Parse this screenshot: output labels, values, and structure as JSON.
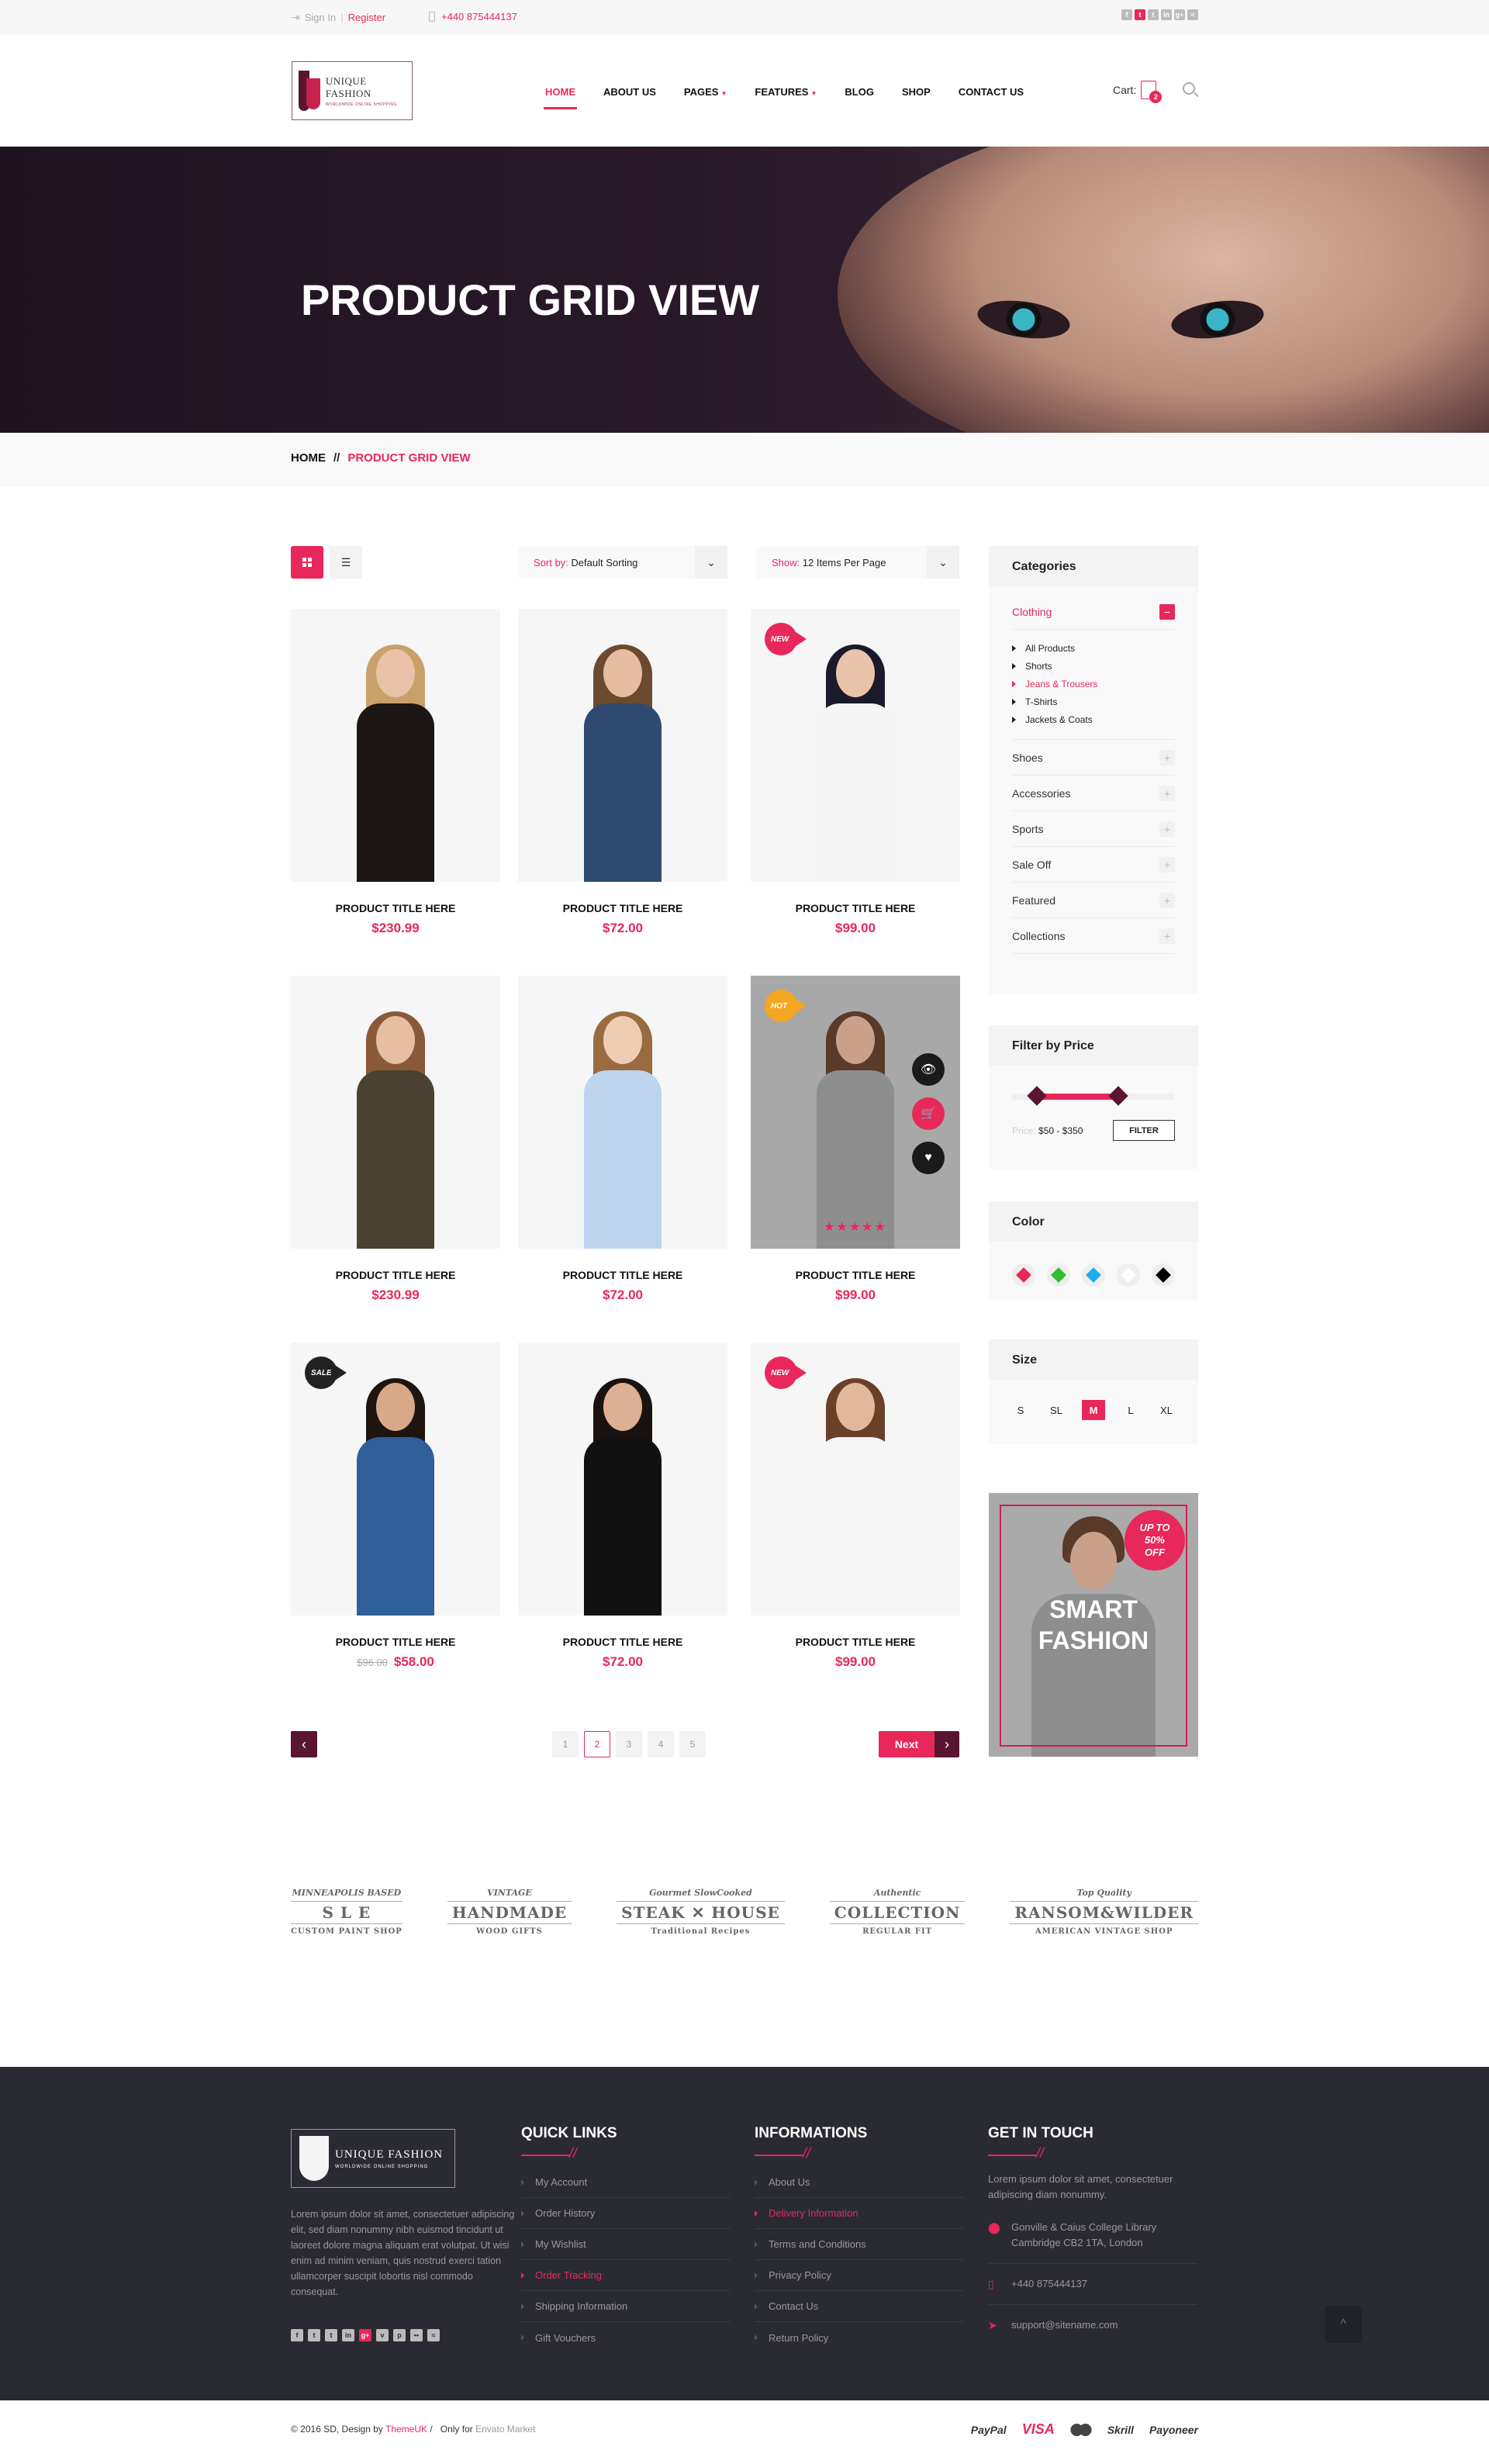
{
  "topbar": {
    "sign_in": "Sign In",
    "separator": "|",
    "register": "Register",
    "phone": "+440 875444137",
    "social": [
      {
        "icon": "facebook-icon",
        "glyph": "f",
        "active": false
      },
      {
        "icon": "twitter-icon",
        "glyph": "t",
        "active": true
      },
      {
        "icon": "tumblr-icon",
        "glyph": "t",
        "active": false
      },
      {
        "icon": "linkedin-icon",
        "glyph": "in",
        "active": false
      },
      {
        "icon": "google-plus-icon",
        "glyph": "g+",
        "active": false
      },
      {
        "icon": "rss-icon",
        "glyph": "≈",
        "active": false
      }
    ]
  },
  "header": {
    "logo_title": "UNIQUE FASHION",
    "logo_tagline": "WORLDWIDE ONLINE SHOPPING",
    "nav": [
      {
        "label": "HOME",
        "active": true,
        "dropdown": false
      },
      {
        "label": "ABOUT US",
        "active": false,
        "dropdown": false
      },
      {
        "label": "PAGES",
        "active": false,
        "dropdown": true
      },
      {
        "label": "FEATURES",
        "active": false,
        "dropdown": true
      },
      {
        "label": "BLOG",
        "active": false,
        "dropdown": false
      },
      {
        "label": "SHOP",
        "active": false,
        "dropdown": false
      },
      {
        "label": "CONTACT US",
        "active": false,
        "dropdown": false
      }
    ],
    "cart_label": "Cart:",
    "cart_count": "2"
  },
  "hero": {
    "title": "PRODUCT GRID VIEW"
  },
  "breadcrumb": {
    "home": "HOME",
    "separator": "//",
    "current": "PRODUCT GRID VIEW"
  },
  "toolbar": {
    "sort_label": "Sort by:",
    "sort_value": "Default Sorting",
    "show_label": "Show:",
    "show_value": "12 Items Per Page",
    "view_mode": "grid"
  },
  "products": [
    {
      "title": "PRODUCT TITLE HERE",
      "price": "$230.99",
      "old_price": null,
      "badge": null,
      "hair": "#c9a06a",
      "skin": "#e9c3a8",
      "outfit": "#1c1614"
    },
    {
      "title": "PRODUCT TITLE HERE",
      "price": "$72.00",
      "old_price": null,
      "badge": null,
      "hair": "#6b4a30",
      "skin": "#e6bda0",
      "outfit": "#2e4a70"
    },
    {
      "title": "PRODUCT TITLE HERE",
      "price": "$99.00",
      "old_price": null,
      "badge": "NEW",
      "badge_color": "#e8275a",
      "hair": "#1a1a2a",
      "skin": "#e8c4aa",
      "outfit": "#f5f5f5"
    },
    {
      "title": "PRODUCT TITLE HERE",
      "price": "$230.99",
      "old_price": null,
      "badge": null,
      "hair": "#8a5a38",
      "skin": "#e6bfa2",
      "outfit": "#4a4232"
    },
    {
      "title": "PRODUCT TITLE HERE",
      "price": "$72.00",
      "old_price": null,
      "badge": null,
      "hair": "#9a6a40",
      "skin": "#efcdb4",
      "outfit": "#bcd4ee"
    },
    {
      "title": "PRODUCT TITLE HERE",
      "price": "$99.00",
      "old_price": null,
      "badge": "HOT",
      "badge_color": "#f5a623",
      "hover": true,
      "rating": 5,
      "hair": "#5a3a28",
      "skin": "#c9a08a",
      "outfit": "#8e8e8e"
    },
    {
      "title": "PRODUCT TITLE HERE",
      "price": "$58.00",
      "old_price": "$96.00",
      "badge": "SALE",
      "badge_color": "#222222",
      "hair": "#1e1410",
      "skin": "#d8a888",
      "outfit": "#2f5f98"
    },
    {
      "title": "PRODUCT TITLE HERE",
      "price": "$72.00",
      "old_price": null,
      "badge": null,
      "hair": "#1a1210",
      "skin": "#dcb094",
      "outfit": "#111111"
    },
    {
      "title": "PRODUCT TITLE HERE",
      "price": "$99.00",
      "old_price": null,
      "badge": "NEW",
      "badge_color": "#e8275a",
      "hair": "#6a4028",
      "skin": "#e0b89c",
      "outfit": "#f6f6f6"
    }
  ],
  "product_actions": {
    "quick_view": "quick-view",
    "add_to_cart": "add-to-cart",
    "wishlist": "wishlist"
  },
  "pagination": {
    "pages": [
      "1",
      "2",
      "3",
      "4",
      "5"
    ],
    "current": "2",
    "prev": "‹",
    "next_label": "Next",
    "next_arrow": "›"
  },
  "sidebar": {
    "categories_title": "Categories",
    "categories": [
      {
        "label": "Clothing",
        "open": true,
        "toggle": "−",
        "children": [
          {
            "label": "All Products",
            "active": false
          },
          {
            "label": "Shorts",
            "active": false
          },
          {
            "label": "Jeans & Trousers",
            "active": true
          },
          {
            "label": "T-Shirts",
            "active": false
          },
          {
            "label": "Jackets & Coats",
            "active": false
          }
        ]
      },
      {
        "label": "Shoes",
        "open": false,
        "toggle": "+"
      },
      {
        "label": "Accessories",
        "open": false,
        "toggle": "+"
      },
      {
        "label": "Sports",
        "open": false,
        "toggle": "+"
      },
      {
        "label": "Sale Off",
        "open": false,
        "toggle": "+"
      },
      {
        "label": "Featured",
        "open": false,
        "toggle": "+"
      },
      {
        "label": "Collections",
        "open": false,
        "toggle": "+"
      }
    ],
    "price_title": "Filter by Price",
    "price_label": "Price:",
    "price_range": "$50 - $350",
    "price_slider": {
      "min_fraction": 0.15,
      "max_fraction": 0.65
    },
    "filter_button": "FILTER",
    "color_title": "Color",
    "colors": [
      {
        "name": "pink",
        "hex": "#e8275a"
      },
      {
        "name": "green",
        "hex": "#2fbf2f"
      },
      {
        "name": "blue",
        "hex": "#1eaee8"
      },
      {
        "name": "white",
        "hex": "#ffffff"
      },
      {
        "name": "black",
        "hex": "#000000"
      }
    ],
    "size_title": "Size",
    "sizes": [
      {
        "label": "S",
        "active": false
      },
      {
        "label": "SL",
        "active": false
      },
      {
        "label": "M",
        "active": true
      },
      {
        "label": "L",
        "active": false
      },
      {
        "label": "XL",
        "active": false
      }
    ],
    "promo": {
      "badge_line1": "UP TO",
      "badge_line2": "50%",
      "badge_line3": "OFF",
      "title_line1": "SMART",
      "title_line2": "FASHION"
    }
  },
  "brands": [
    {
      "name": "Minneapolis Based Custom Paint Shop",
      "top": "MINNEAPOLIS BASED",
      "main": "S L E",
      "bottom": "CUSTOM PAINT SHOP"
    },
    {
      "name": "Vintage Handmade Wood Gifts",
      "top": "VINTAGE",
      "main": "HANDMADE",
      "bottom": "WOOD GIFTS"
    },
    {
      "name": "Steak House",
      "top": "Gourmet SlowCooked",
      "main": "STEAK ✕ HOUSE",
      "bottom": "Traditional Recipes"
    },
    {
      "name": "Authentic Collection Regular Fit",
      "top": "Authentic",
      "main": "COLLECTION",
      "bottom": "REGULAR FIT"
    },
    {
      "name": "Ransom & Wilder",
      "top": "Top Quality",
      "main": "RANSOM&WILDER",
      "bottom": "AMERICAN VINTAGE SHOP"
    }
  ],
  "footer": {
    "logo_title": "UNIQUE FASHION",
    "logo_tagline": "WORLDWIDE ONLINE SHOPPING",
    "about": "Lorem ipsum dolor sit amet, consectetuer adipiscing elit, sed diam nonummy nibh euismod tincidunt ut laoreet dolore magna aliquam erat volutpat. Ut wisi enim ad minim veniam, quis nostrud exerci tation ullamcorper suscipit lobortis nisl commodo consequat.",
    "social": [
      {
        "icon": "facebook-icon",
        "glyph": "f",
        "active": false
      },
      {
        "icon": "twitter-icon",
        "glyph": "t",
        "active": false
      },
      {
        "icon": "tumblr-icon",
        "glyph": "t",
        "active": false
      },
      {
        "icon": "linkedin-icon",
        "glyph": "in",
        "active": false
      },
      {
        "icon": "google-plus-icon",
        "glyph": "g+",
        "active": true
      },
      {
        "icon": "vimeo-icon",
        "glyph": "v",
        "active": false
      },
      {
        "icon": "pinterest-icon",
        "glyph": "p",
        "active": false
      },
      {
        "icon": "flickr-icon",
        "glyph": "••",
        "active": false
      },
      {
        "icon": "rss-icon",
        "glyph": "≈",
        "active": false
      }
    ],
    "quick_links_title": "QUICK LINKS",
    "quick_links": [
      {
        "label": "My Account",
        "active": false
      },
      {
        "label": "Order History",
        "active": false
      },
      {
        "label": "My Wishlist",
        "active": false
      },
      {
        "label": "Order Tracking",
        "active": true
      },
      {
        "label": "Shipping Information",
        "active": false
      },
      {
        "label": "Gift Vouchers",
        "active": false
      }
    ],
    "info_title": "INFORMATIONS",
    "info_links": [
      {
        "label": "About Us",
        "active": false
      },
      {
        "label": "Delivery Information",
        "active": true
      },
      {
        "label": "Terms and Conditions",
        "active": false
      },
      {
        "label": "Privacy Policy",
        "active": false
      },
      {
        "label": "Contact Us",
        "active": false
      },
      {
        "label": "Return Policy",
        "active": false
      }
    ],
    "contact_title": "GET IN TOUCH",
    "contact_intro": "Lorem ipsum dolor sit amet, consectetuer adipiscing diam nonummy.",
    "address_line1": "Gonville & Caius College Library",
    "address_line2": "Cambridge CB2 1TA, London",
    "phone": "+440 875444137",
    "email": "support@sitename.com",
    "to_top": "^"
  },
  "bottom": {
    "copyright": "© 2016 SD, Design by",
    "designer": "ThemeUK",
    "sep": " /",
    "only_for": "Only for",
    "market": "Envato Market",
    "payments": [
      "PayPal",
      "VISA",
      "MasterCard",
      "Skrill",
      "Payoneer"
    ]
  }
}
